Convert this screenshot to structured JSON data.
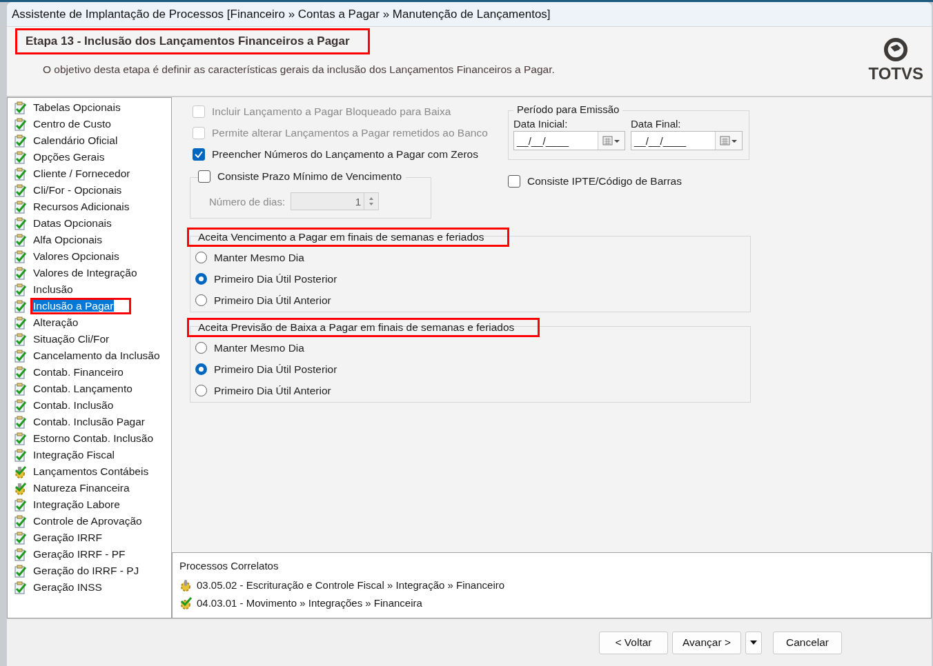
{
  "window": {
    "title": "Assistente de Implantação de Processos [Financeiro » Contas a Pagar » Manutenção de Lançamentos]"
  },
  "header": {
    "title": "Etapa 13 - Inclusão dos Lançamentos Financeiros a Pagar",
    "highlighted": true,
    "description": "O objetivo desta etapa é definir as características gerais da inclusão dos Lançamentos Financeiros a Pagar.",
    "logo": "TOTVS"
  },
  "steps": [
    {
      "label": "Tabelas Opcionais",
      "kind": "done",
      "selected": false,
      "highlighted": false
    },
    {
      "label": "Centro de Custo",
      "kind": "done",
      "selected": false,
      "highlighted": false
    },
    {
      "label": "Calendário Oficial",
      "kind": "done",
      "selected": false,
      "highlighted": false
    },
    {
      "label": "Opções Gerais",
      "kind": "done",
      "selected": false,
      "highlighted": false
    },
    {
      "label": "Cliente / Fornecedor",
      "kind": "done",
      "selected": false,
      "highlighted": false
    },
    {
      "label": "Cli/For - Opcionais",
      "kind": "done",
      "selected": false,
      "highlighted": false
    },
    {
      "label": "Recursos Adicionais",
      "kind": "done",
      "selected": false,
      "highlighted": false
    },
    {
      "label": "Datas Opcionais",
      "kind": "done",
      "selected": false,
      "highlighted": false
    },
    {
      "label": "Alfa Opcionais",
      "kind": "done",
      "selected": false,
      "highlighted": false
    },
    {
      "label": "Valores Opcionais",
      "kind": "done",
      "selected": false,
      "highlighted": false
    },
    {
      "label": "Valores de Integração",
      "kind": "done",
      "selected": false,
      "highlighted": false
    },
    {
      "label": "Inclusão",
      "kind": "done",
      "selected": false,
      "highlighted": false
    },
    {
      "label": "Inclusão a Pagar",
      "kind": "done",
      "selected": true,
      "highlighted": true
    },
    {
      "label": "Alteração",
      "kind": "done",
      "selected": false,
      "highlighted": false
    },
    {
      "label": "Situação Cli/For",
      "kind": "done",
      "selected": false,
      "highlighted": false
    },
    {
      "label": "Cancelamento da Inclusão",
      "kind": "done",
      "selected": false,
      "highlighted": false
    },
    {
      "label": "Contab. Financeiro",
      "kind": "done",
      "selected": false,
      "highlighted": false
    },
    {
      "label": "Contab. Lançamento",
      "kind": "done",
      "selected": false,
      "highlighted": false
    },
    {
      "label": "Contab. Inclusão",
      "kind": "done",
      "selected": false,
      "highlighted": false
    },
    {
      "label": "Contab. Inclusão Pagar",
      "kind": "done",
      "selected": false,
      "highlighted": false
    },
    {
      "label": "Estorno Contab. Inclusão",
      "kind": "done",
      "selected": false,
      "highlighted": false
    },
    {
      "label": "Integração Fiscal",
      "kind": "done",
      "selected": false,
      "highlighted": false
    },
    {
      "label": "Lançamentos Contábeis",
      "kind": "gear",
      "selected": false,
      "highlighted": false
    },
    {
      "label": "Natureza Financeira",
      "kind": "gear",
      "selected": false,
      "highlighted": false
    },
    {
      "label": "Integração Labore",
      "kind": "done",
      "selected": false,
      "highlighted": false
    },
    {
      "label": "Controle de Aprovação",
      "kind": "done",
      "selected": false,
      "highlighted": false
    },
    {
      "label": "Geração IRRF",
      "kind": "done",
      "selected": false,
      "highlighted": false
    },
    {
      "label": "Geração IRRF - PF",
      "kind": "done",
      "selected": false,
      "highlighted": false
    },
    {
      "label": "Geração do IRRF - PJ",
      "kind": "done",
      "selected": false,
      "highlighted": false
    },
    {
      "label": "Geração INSS",
      "kind": "done",
      "selected": false,
      "highlighted": false
    }
  ],
  "options": [
    {
      "label": "Incluir Lançamento a Pagar Bloqueado para Baixa",
      "checked": false,
      "disabled": true
    },
    {
      "label": "Permite alterar Lançamentos a Pagar remetidos ao Banco",
      "checked": false,
      "disabled": true
    },
    {
      "label": "Preencher Números do Lançamento a Pagar com Zeros",
      "checked": true,
      "disabled": false
    }
  ],
  "prazo": {
    "label": "Consiste Prazo Mínimo de Vencimento",
    "checked": false,
    "days_label": "Número de dias:",
    "days_value": "1",
    "disabled": true
  },
  "periodo": {
    "title": "Período para Emissão",
    "fields": [
      {
        "label": "Data Inicial:",
        "value": "__/__/____"
      },
      {
        "label": "Data Final:",
        "value": "__/__/____"
      }
    ]
  },
  "ipte": {
    "label": "Consiste IPTE/Código de Barras",
    "checked": false
  },
  "radio_groups": [
    {
      "title": "Aceita Vencimento a Pagar em finais de semanas e feriados",
      "highlighted": true,
      "options": [
        {
          "label": "Manter Mesmo Dia",
          "selected": false
        },
        {
          "label": "Primeiro Dia Útil Posterior",
          "selected": true
        },
        {
          "label": "Primeiro Dia Útil Anterior",
          "selected": false
        }
      ]
    },
    {
      "title": "Aceita Previsão de Baixa a Pagar em finais de semanas e feriados",
      "highlighted": true,
      "options": [
        {
          "label": "Manter Mesmo Dia",
          "selected": false
        },
        {
          "label": "Primeiro Dia Útil Posterior",
          "selected": true
        },
        {
          "label": "Primeiro Dia Útil Anterior",
          "selected": false
        }
      ]
    }
  ],
  "related": {
    "title": "Processos Correlatos",
    "items": [
      {
        "text": "03.05.02 - Escrituração e Controle Fiscal » Integração » Financeiro",
        "kind": "gear"
      },
      {
        "text": "04.03.01 - Movimento » Integrações » Financeira",
        "kind": "gear-done"
      }
    ]
  },
  "buttons": [
    {
      "label": "< Voltar",
      "kind": "button"
    },
    {
      "label": "Avançar >",
      "kind": "button"
    },
    {
      "kind": "dropdown"
    },
    {
      "label": "Cancelar",
      "kind": "button"
    }
  ]
}
